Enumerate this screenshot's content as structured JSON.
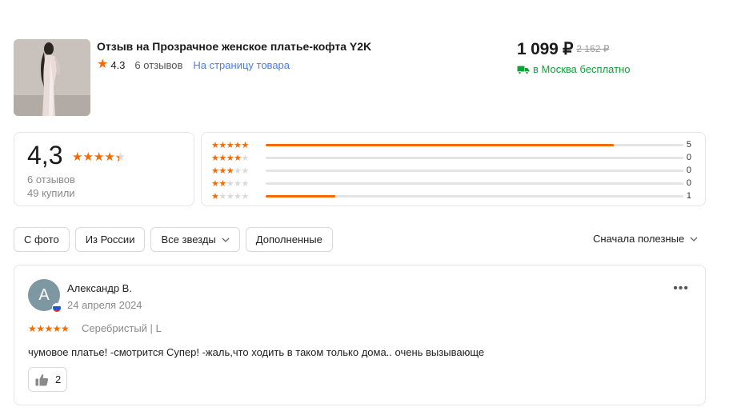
{
  "product": {
    "title": "Отзыв на Прозрачное женское платье-кофта Y2K",
    "rating": "4.3",
    "reviews_count": "6 отзывов",
    "product_link": "На страницу товара",
    "price": "1 099 ₽",
    "old_price": "2 162 ₽",
    "delivery": "в Москва бесплатно",
    "image_icon": "product-photo"
  },
  "summary": {
    "rating": "4,3",
    "reviews": "6 отзывов",
    "bought": "49 купили"
  },
  "distribution": [
    {
      "stars": 5,
      "count": "5",
      "fraction": 0.833
    },
    {
      "stars": 4,
      "count": "0",
      "fraction": 0
    },
    {
      "stars": 3,
      "count": "0",
      "fraction": 0
    },
    {
      "stars": 2,
      "count": "0",
      "fraction": 0
    },
    {
      "stars": 1,
      "count": "1",
      "fraction": 0.167
    }
  ],
  "filters": {
    "with_photo": "С фото",
    "from_russia": "Из России",
    "all_stars": "Все звезды",
    "supplemented": "Дополненные",
    "sort": "Сначала полезные"
  },
  "review": {
    "avatar_letter": "А",
    "author": "Александр В.",
    "date": "24 апреля 2024",
    "variant": "Серебристый | L",
    "text": "чумовое платье! -смотрится Супер! -жаль,что ходить в таком только дома.. очень вызывающе",
    "likes": "2",
    "stars": 5
  },
  "colors": {
    "accent": "#f56b00",
    "link": "#4a7ee6",
    "delivery": "#14a03a",
    "avatar": "#7e98a3"
  }
}
